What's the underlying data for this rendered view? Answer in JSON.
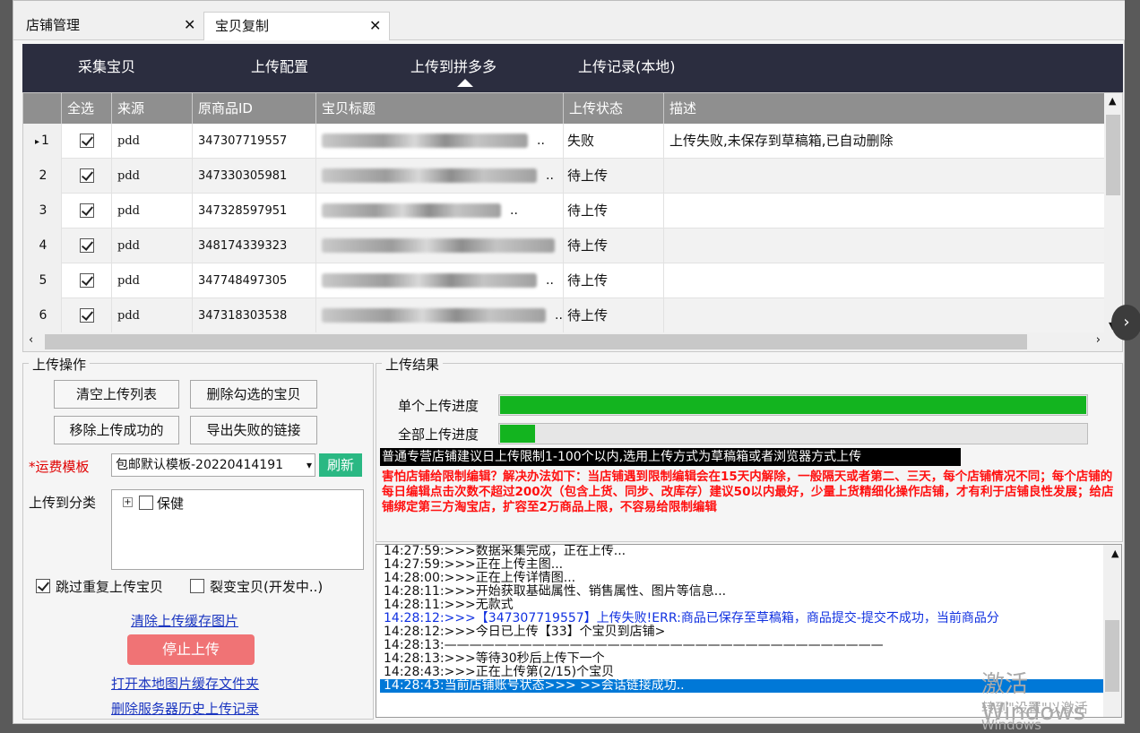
{
  "doc_tabs": [
    {
      "label": "店铺管理"
    },
    {
      "label": "宝贝复制"
    }
  ],
  "close_glyph": "✕",
  "nav": {
    "items": [
      "采集宝贝",
      "上传配置",
      "上传到拼多多",
      "上传记录(本地)"
    ]
  },
  "grid": {
    "columns": [
      "全选",
      "来源",
      "原商品ID",
      "宝贝标题",
      "上传状态",
      "描述"
    ],
    "rows": [
      {
        "no": "1",
        "marker": "▸",
        "checked": true,
        "source": "pdd",
        "id": "347307719557",
        "status": "失败",
        "desc": "上传失败,未保存到草稿箱,已自动删除"
      },
      {
        "no": "2",
        "marker": "",
        "checked": true,
        "source": "pdd",
        "id": "347330305981",
        "status": "待上传",
        "desc": ""
      },
      {
        "no": "3",
        "marker": "",
        "checked": true,
        "source": "pdd",
        "id": "347328597951",
        "status": "待上传",
        "desc": ""
      },
      {
        "no": "4",
        "marker": "",
        "checked": true,
        "source": "pdd",
        "id": "348174339323",
        "status": "待上传",
        "desc": ""
      },
      {
        "no": "5",
        "marker": "",
        "checked": true,
        "source": "pdd",
        "id": "347748497305",
        "status": "待上传",
        "desc": ""
      },
      {
        "no": "6",
        "marker": "",
        "checked": true,
        "source": "pdd",
        "id": "347318303538",
        "status": "待上传",
        "desc": ""
      }
    ],
    "ellipsis": ".."
  },
  "upload_ops": {
    "title": "上传操作",
    "buttons": [
      "清空上传列表",
      "删除勾选的宝贝",
      "移除上传成功的",
      "导出失败的链接"
    ],
    "shipping_label": "*运费模板",
    "shipping_value": "包邮默认模板-20220414191",
    "refresh": "刷新",
    "category_label": "上传到分类",
    "category_tree": "保健",
    "skip_dup": "跳过重复上传宝贝",
    "fission": "裂变宝贝(开发中..)",
    "clear_cache": "清除上传缓存图片",
    "stop": "停止上传",
    "open_folder": "打开本地图片缓存文件夹",
    "delete_history": "删除服务器历史上传记录"
  },
  "results": {
    "title": "上传结果",
    "single_label": "单个上传进度",
    "all_label": "全部上传进度",
    "single_progress": 1.0,
    "all_progress": 0.06,
    "notice": "普通专营店铺建议日上传限制1-100个以内,选用上传方式为草稿箱或者浏览器方式上传",
    "warning": "害怕店铺给限制编辑？解决办法如下：当店铺遇到限制编辑会在15天内解除，一般隔天或者第二、三天，每个店铺情况不同；每个店铺的每日编辑点击次数不超过200次（包含上货、同步、改库存）建议50以内最好，少量上货精细化操作店铺，才有利于店铺良性发展；给店铺绑定第三方淘宝店，扩容至2万商品上限，不容易给限制编辑"
  },
  "log": [
    {
      "text": "14:27:59:>>>数据采集完成，正在上传...",
      "style": ""
    },
    {
      "text": "14:27:59:>>>正在上传主图...",
      "style": ""
    },
    {
      "text": "14:28:00:>>>正在上传详情图...",
      "style": ""
    },
    {
      "text": "14:28:11:>>>开始获取基础属性、销售属性、图片等信息...",
      "style": ""
    },
    {
      "text": "14:28:11:>>>无款式",
      "style": ""
    },
    {
      "text": "14:28:12:>>>【347307719557】上传失败!ERR:商品已保存至草稿箱，商品提交-提交不成功，当前商品分",
      "style": "blue"
    },
    {
      "text": "14:28:12:>>>今日已上传【33】个宝贝到店铺>",
      "style": ""
    },
    {
      "text": "14:28:13:———————————————————————————————————",
      "style": ""
    },
    {
      "text": "14:28:13:>>>等待30秒后上传下一个",
      "style": ""
    },
    {
      "text": "14:28:43:>>>正在上传第(2/15)个宝贝",
      "style": ""
    },
    {
      "text": "14:28:43:当前店铺账号状态>>>     >>会话链接成功..",
      "style": "sel"
    }
  ],
  "watermark": {
    "line1": "激活 Windows",
    "line2": "转到\"设置\"以激活 Windows"
  }
}
